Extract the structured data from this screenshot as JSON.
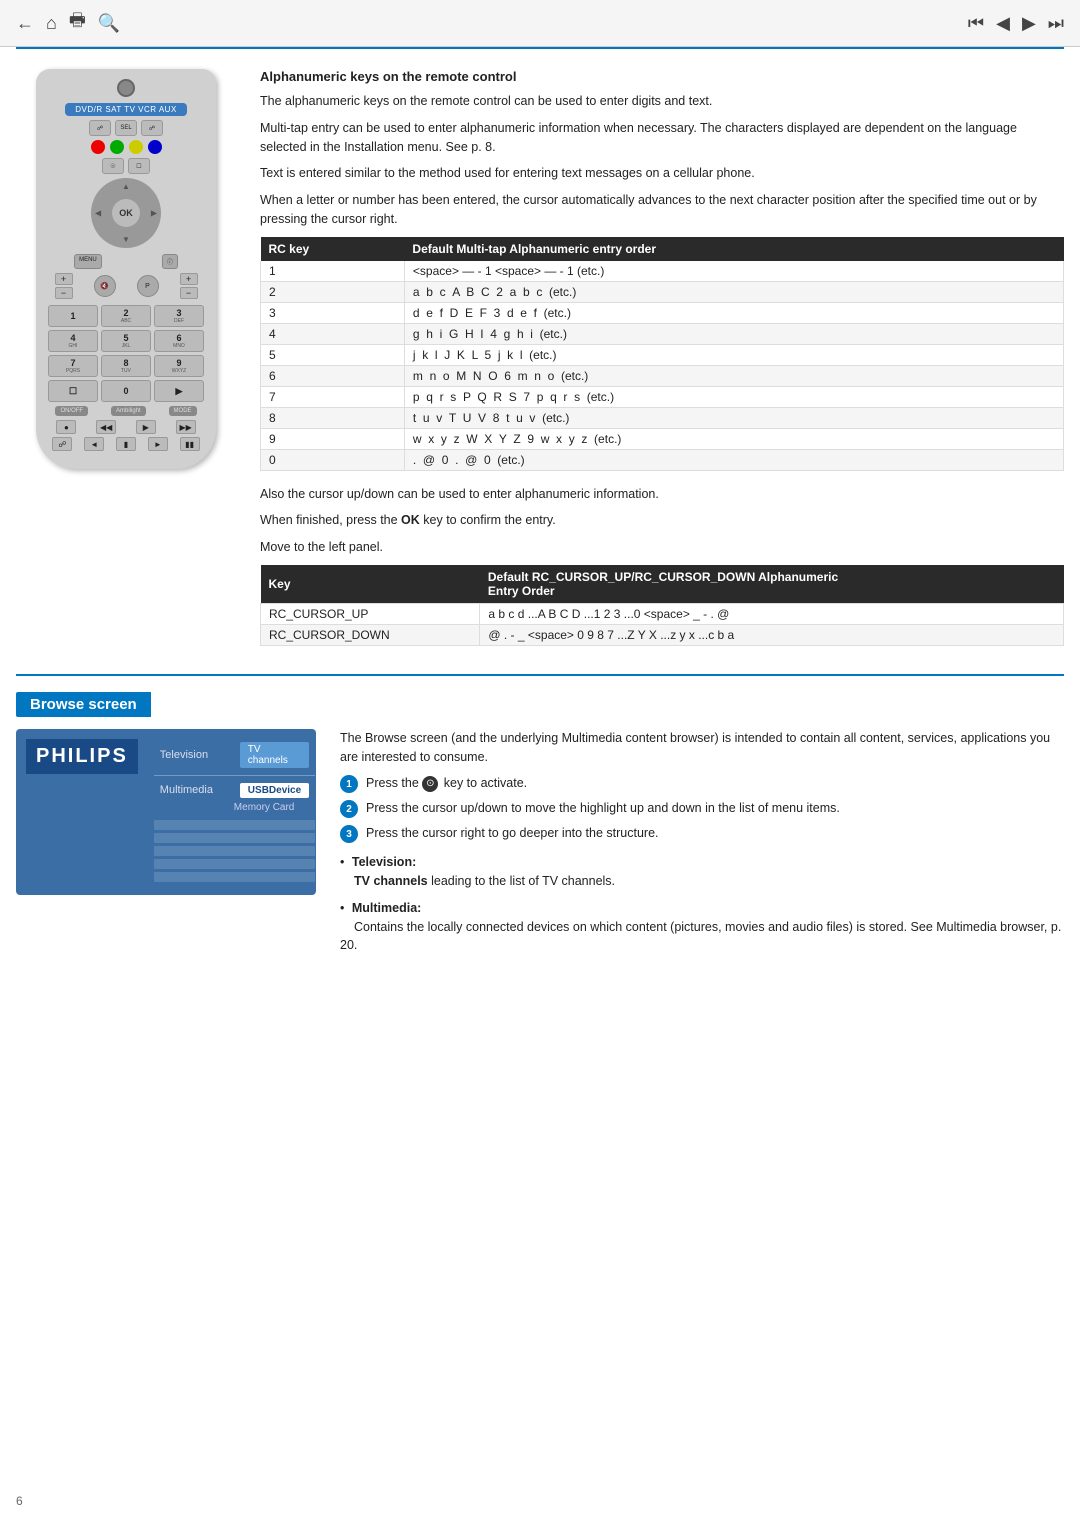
{
  "topNav": {
    "leftIcons": [
      "back-arrow",
      "home",
      "print",
      "search"
    ],
    "rightIcons": [
      "skip-back",
      "rewind",
      "fast-forward",
      "skip-forward"
    ]
  },
  "section1": {
    "heading": "Alphanumeric keys on the remote control",
    "paragraphs": [
      "The alphanumeric keys on the remote control can be used to enter digits and text.",
      "Multi-tap entry can be used to enter alphanumeric information when necessary. The characters displayed are dependent on the language selected in the Installation menu. See p. 8.",
      "Text is entered similar to the method used for entering text messages on a cellular phone.",
      "When a letter or number has been entered, the cursor automatically advances to the next character position after the specified time out or by pressing the cursor right."
    ],
    "table1": {
      "headers": [
        "RC key",
        "Default Multi-tap Alphanumeric entry order"
      ],
      "rows": [
        [
          "1",
          "<space> — - 1 <space> — - 1 (etc.)"
        ],
        [
          "2",
          "a  b  c  A  B  C  2  a  b  c  (etc.)"
        ],
        [
          "3",
          "d  e  f  D  E  F  3  d  e  f  (etc.)"
        ],
        [
          "4",
          "g  h  i  G  H  I  4  g  h  i  (etc.)"
        ],
        [
          "5",
          "j  k  l  J  K  L  5  j  k  l  (etc.)"
        ],
        [
          "6",
          "m  n  o  M  N  O  6  m  n  o  (etc.)"
        ],
        [
          "7",
          "p  q  r  s  P  Q  R  S  7  p  q  r  s  (etc.)"
        ],
        [
          "8",
          "t  u  v  T  U  V  8  t  u  v  (etc.)"
        ],
        [
          "9",
          "w  x  y  z  W  X  Y  Z  9  w  x  y  z  (etc.)"
        ],
        [
          "0",
          ".  @  0  .  @  0  (etc.)"
        ]
      ]
    },
    "midText": [
      "Also the cursor up/down can be used to enter alphanumeric information.",
      "When finished, press the OK key to confirm the entry.",
      "Move to the left panel."
    ],
    "table2": {
      "headers": [
        "Key",
        "Default RC_CURSOR_UP/RC_CURSOR_DOWN Alphanumeric Entry Order"
      ],
      "rows": [
        [
          "RC_CURSOR_UP",
          "a b c d ...A B C D ...1 2 3 ...0 <space> _ - . @"
        ],
        [
          "RC_CURSOR_DOWN",
          "@ . - _ <space> 0 9 8 7 ...Z Y X ...z y x ...c b a"
        ]
      ]
    }
  },
  "browseSection": {
    "title": "Browse screen",
    "philipsScreen": {
      "logo": "PHILIPS",
      "menuItems": [
        {
          "category": "Television",
          "value": "TV channels"
        },
        {
          "category": "Multimedia",
          "value": "USBDevice",
          "subItems": [
            "Memory Card"
          ]
        },
        {
          "category": "",
          "value": ""
        },
        {
          "category": "",
          "value": ""
        },
        {
          "category": "",
          "value": ""
        }
      ]
    },
    "introText": "The Browse screen (and the underlying Multimedia content browser) is intended to contain all content, services, applications you are interested to consume.",
    "steps": [
      "Press the ⊙ key to activate.",
      "Press the cursor up/down to move the highlight up and down in the list of menu items.",
      "Press the cursor right to go deeper into the structure."
    ],
    "bullets": [
      {
        "label": "Television:",
        "text": "TV channels leading to the list of TV channels."
      },
      {
        "label": "Multimedia:",
        "text": "Contains the locally connected devices on which content (pictures, movies and audio files) is stored. See Multimedia browser, p. 20."
      }
    ]
  },
  "pageNumber": "6",
  "remote": {
    "powerBtn": "⏻",
    "sourceBar": "DVD/R SAT TV VCR AUX",
    "okLabel": "OK",
    "numKeys": [
      {
        "num": "1",
        "sub": ""
      },
      {
        "num": "2",
        "sub": "ABC"
      },
      {
        "num": "3",
        "sub": "DEF"
      },
      {
        "num": "4",
        "sub": "GHI"
      },
      {
        "num": "5",
        "sub": "JKL"
      },
      {
        "num": "6",
        "sub": "MNO"
      },
      {
        "num": "7",
        "sub": "PQRS"
      },
      {
        "num": "8",
        "sub": "TUV"
      },
      {
        "num": "9",
        "sub": "WXYZ"
      },
      {
        "num": "",
        "sub": ""
      },
      {
        "num": "0",
        "sub": ""
      },
      {
        "num": "",
        "sub": ""
      }
    ]
  }
}
